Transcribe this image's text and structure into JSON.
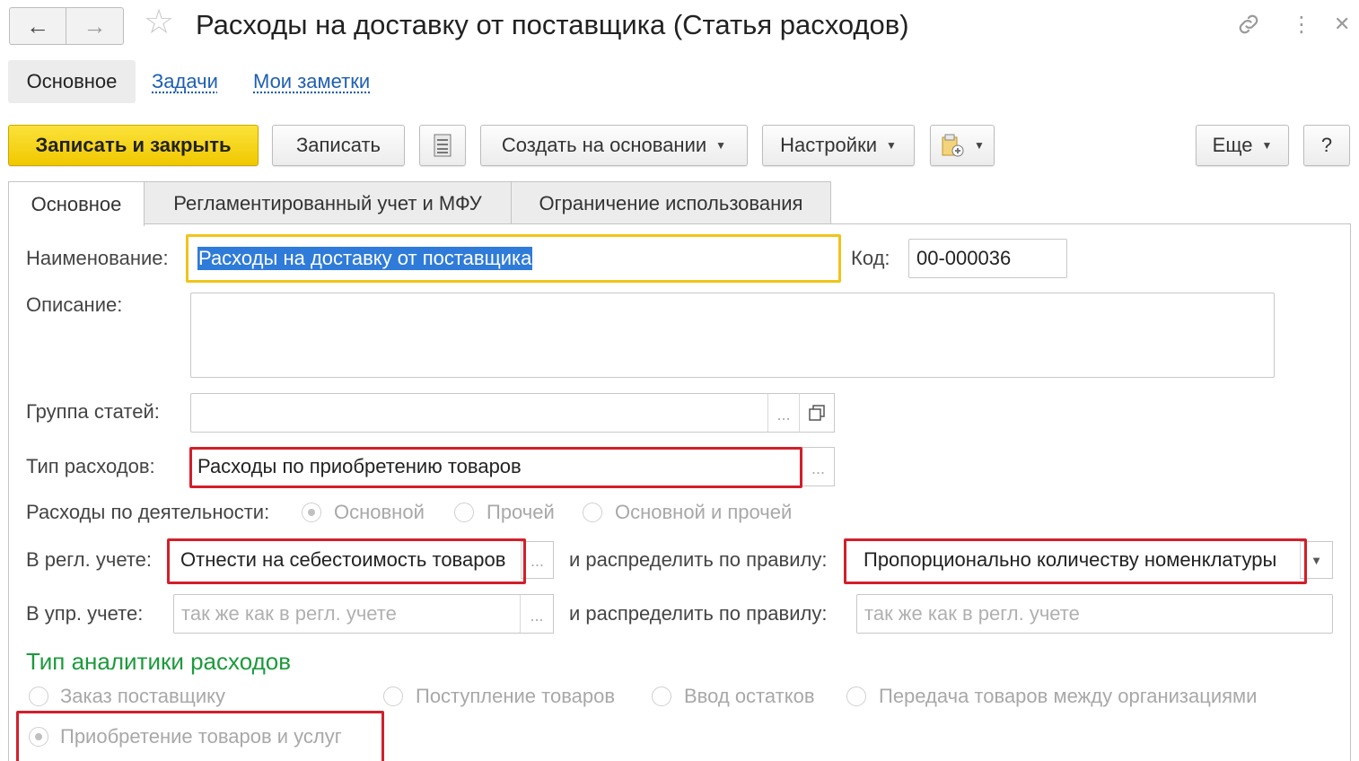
{
  "window": {
    "title": "Расходы на доставку от поставщика (Статья расходов)",
    "back_icon": "←",
    "forward_icon": "→",
    "star_icon": "☆",
    "link_icon": "🔗",
    "more_icon": "⋮",
    "close_icon": "✕"
  },
  "sections": {
    "main": "Основное",
    "tasks": "Задачи",
    "notes": "Мои заметки"
  },
  "toolbar": {
    "save_close": "Записать и закрыть",
    "save": "Записать",
    "create_based": "Создать на основании",
    "settings": "Настройки",
    "more": "Еще",
    "help": "?"
  },
  "tabs": {
    "main": "Основное",
    "regulated": "Регламентированный учет и МФУ",
    "restriction": "Ограничение использования"
  },
  "form": {
    "name_label": "Наименование:",
    "name_value": "Расходы на доставку от поставщика",
    "code_label": "Код:",
    "code_value": "00-000036",
    "description_label": "Описание:",
    "description_value": "",
    "group_label": "Группа статей:",
    "group_value": "",
    "expense_type_label": "Тип расходов:",
    "expense_type_value": "Расходы по приобретению товаров",
    "activity_label": "Расходы по деятельности:",
    "activity_options": [
      "Основной",
      "Прочей",
      "Основной и прочей"
    ],
    "regl_label": "В регл. учете:",
    "regl_value": "Отнести на себестоимость товаров",
    "regl_rule_label": "и распределить по правилу:",
    "regl_rule_value": "Пропорционально количеству номенклатуры",
    "mgmt_label": "В упр. учете:",
    "mgmt_placeholder": "так же как в регл. учете",
    "mgmt_rule_label": "и распределить по правилу:",
    "mgmt_rule_placeholder": "так же как в регл. учете",
    "analytics_title": "Тип аналитики расходов",
    "analytics_options": [
      "Заказ поставщику",
      "Поступление товаров",
      "Ввод остатков",
      "Передача товаров между организациями",
      "Приобретение товаров и услуг"
    ]
  },
  "colors": {
    "accent_yellow": "#f0c800",
    "highlight_red": "#d21f2a",
    "section_green": "#1c9a3c",
    "link_blue": "#1f5fb0"
  }
}
